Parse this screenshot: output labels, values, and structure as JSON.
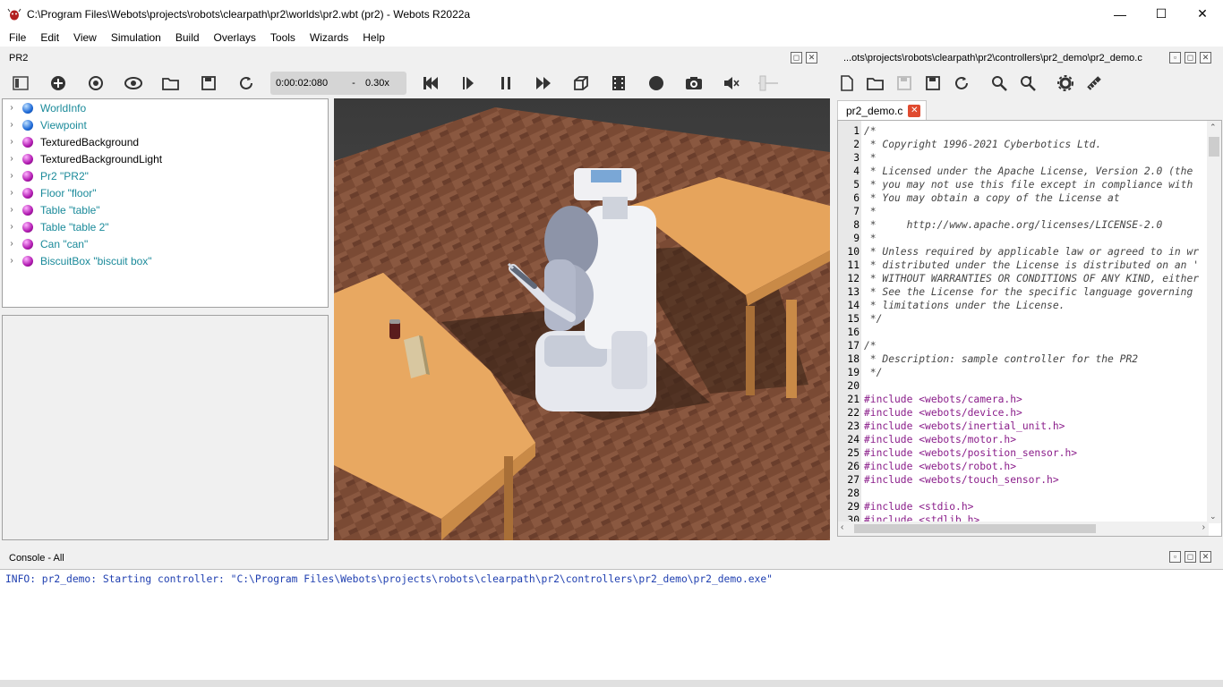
{
  "window": {
    "title": "C:\\Program Files\\Webots\\projects\\robots\\clearpath\\pr2\\worlds\\pr2.wbt (pr2) - Webots R2022a",
    "minimize": "—",
    "maximize": "☐",
    "close": "✕"
  },
  "menu": [
    "File",
    "Edit",
    "View",
    "Simulation",
    "Build",
    "Overlays",
    "Tools",
    "Wizards",
    "Help"
  ],
  "scene_panel": {
    "title": "PR2"
  },
  "editor_panel": {
    "title": "...ots\\projects\\robots\\clearpath\\pr2\\controllers\\pr2_demo\\pr2_demo.c"
  },
  "simulation": {
    "time": "0:00:02:080",
    "separator": "-",
    "speed": "0.30x"
  },
  "scene_tree": [
    {
      "label": "WorldInfo",
      "color": "blue",
      "teal": true
    },
    {
      "label": "Viewpoint",
      "color": "blue",
      "teal": true
    },
    {
      "label": "TexturedBackground",
      "color": "purple",
      "teal": false
    },
    {
      "label": "TexturedBackgroundLight",
      "color": "purple",
      "teal": false
    },
    {
      "label": "Pr2 \"PR2\"",
      "color": "purple",
      "teal": true
    },
    {
      "label": "Floor \"floor\"",
      "color": "purple",
      "teal": true
    },
    {
      "label": "Table \"table\"",
      "color": "purple",
      "teal": true
    },
    {
      "label": "Table \"table 2\"",
      "color": "purple",
      "teal": true
    },
    {
      "label": "Can \"can\"",
      "color": "purple",
      "teal": true
    },
    {
      "label": "BiscuitBox \"biscuit box\"",
      "color": "purple",
      "teal": true
    }
  ],
  "editor": {
    "tab": "pr2_demo.c",
    "tab_close": "✕",
    "lines": [
      {
        "n": "1",
        "t": "/*",
        "k": "com"
      },
      {
        "n": "2",
        "t": " * Copyright 1996-2021 Cyberbotics Ltd.",
        "k": "com"
      },
      {
        "n": "3",
        "t": " *",
        "k": "com"
      },
      {
        "n": "4",
        "t": " * Licensed under the Apache License, Version 2.0 (the",
        "k": "com"
      },
      {
        "n": "5",
        "t": " * you may not use this file except in compliance with",
        "k": "com"
      },
      {
        "n": "6",
        "t": " * You may obtain a copy of the License at",
        "k": "com"
      },
      {
        "n": "7",
        "t": " *",
        "k": "com"
      },
      {
        "n": "8",
        "t": " *     http://www.apache.org/licenses/LICENSE-2.0",
        "k": "com"
      },
      {
        "n": "9",
        "t": " *",
        "k": "com"
      },
      {
        "n": "10",
        "t": " * Unless required by applicable law or agreed to in wr",
        "k": "com"
      },
      {
        "n": "11",
        "t": " * distributed under the License is distributed on an '",
        "k": "com"
      },
      {
        "n": "12",
        "t": " * WITHOUT WARRANTIES OR CONDITIONS OF ANY KIND, either",
        "k": "com"
      },
      {
        "n": "13",
        "t": " * See the License for the specific language governing",
        "k": "com"
      },
      {
        "n": "14",
        "t": " * limitations under the License.",
        "k": "com"
      },
      {
        "n": "15",
        "t": " */",
        "k": "com"
      },
      {
        "n": "16",
        "t": "",
        "k": "com"
      },
      {
        "n": "17",
        "t": "/*",
        "k": "com"
      },
      {
        "n": "18",
        "t": " * Description: sample controller for the PR2",
        "k": "com"
      },
      {
        "n": "19",
        "t": " */",
        "k": "com"
      },
      {
        "n": "20",
        "t": "",
        "k": "com"
      },
      {
        "n": "21",
        "t": "#include <webots/camera.h>",
        "k": "pre"
      },
      {
        "n": "22",
        "t": "#include <webots/device.h>",
        "k": "pre"
      },
      {
        "n": "23",
        "t": "#include <webots/inertial_unit.h>",
        "k": "pre"
      },
      {
        "n": "24",
        "t": "#include <webots/motor.h>",
        "k": "pre"
      },
      {
        "n": "25",
        "t": "#include <webots/position_sensor.h>",
        "k": "pre"
      },
      {
        "n": "26",
        "t": "#include <webots/robot.h>",
        "k": "pre"
      },
      {
        "n": "27",
        "t": "#include <webots/touch_sensor.h>",
        "k": "pre"
      },
      {
        "n": "28",
        "t": "",
        "k": "pre"
      },
      {
        "n": "29",
        "t": "#include <stdio.h>",
        "k": "pre"
      },
      {
        "n": "30",
        "t": "#include <stdlib.h>",
        "k": "pre"
      }
    ]
  },
  "console": {
    "title": "Console - All",
    "line": "INFO: pr2_demo: Starting controller: \"C:\\Program Files\\Webots\\projects\\robots\\clearpath\\pr2\\controllers\\pr2_demo\\pr2_demo.exe\""
  },
  "colors": {
    "teal_label": "#1a8a9a",
    "console_text": "#1f3fb0",
    "include_text": "#8a1d8a"
  },
  "icons": {
    "main_toolbar": [
      "toggle-scene-tree-icon",
      "add-node-icon",
      "view-rotate-icon",
      "view-eye-icon",
      "open-world-icon",
      "save-world-icon",
      "reload-world-icon"
    ],
    "sim_controls": [
      "reset-simulation-icon",
      "step-icon",
      "pause-icon",
      "fast-forward-icon",
      "views-cube-icon",
      "movie-icon",
      "record-icon",
      "screenshot-icon",
      "mute-icon",
      "volume-slider-icon"
    ],
    "editor_toolbar": [
      "new-file-icon",
      "open-file-icon",
      "save-file-icon",
      "save-all-icon",
      "revert-icon",
      "find-icon",
      "replace-icon",
      "build-settings-icon",
      "clean-icon"
    ]
  }
}
